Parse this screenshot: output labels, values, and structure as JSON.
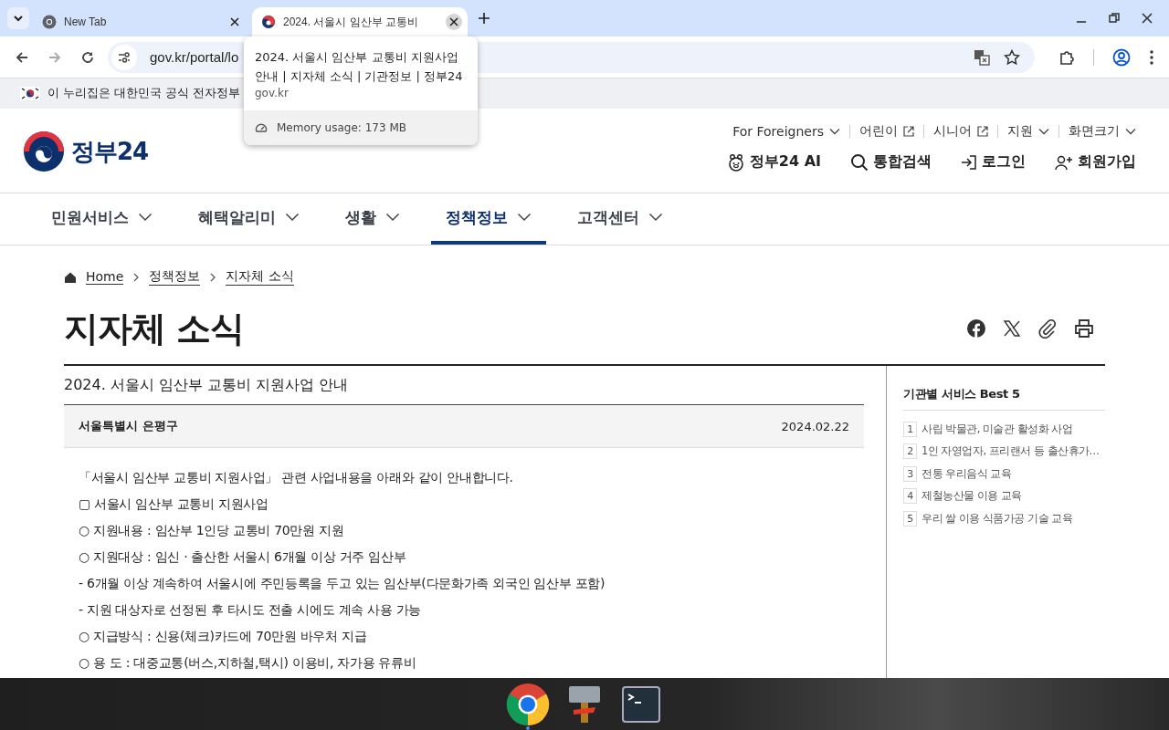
{
  "browser": {
    "tabs": [
      {
        "title": "New Tab",
        "kind": "chrome",
        "selected": false
      },
      {
        "title": "2024. 서울시 임산부 교통비",
        "kind": "site",
        "selected": true
      }
    ],
    "address": "gov.kr/portal/lo",
    "tooltip": {
      "title": "2024. 서울시 임산부 교통비 지원사업 안내 | 지자체 소식 | 기관정보 | 정부24",
      "domain": "gov.kr",
      "memory": "Memory usage: 173 MB"
    }
  },
  "gov_banner": "이 누리집은 대한민국 공식 전자정부",
  "header": {
    "logo_text": "정부24",
    "utility_links": [
      {
        "label": "For Foreigners",
        "kind": "dropdown"
      },
      {
        "label": "어린이",
        "kind": "external"
      },
      {
        "label": "시니어",
        "kind": "external"
      },
      {
        "label": "지원",
        "kind": "dropdown"
      },
      {
        "label": "화면크기",
        "kind": "dropdown"
      }
    ],
    "actions": [
      {
        "label": "정부24 AI",
        "kind": "ai"
      },
      {
        "label": "통합검색",
        "kind": "search"
      },
      {
        "label": "로그인",
        "kind": "login"
      },
      {
        "label": "회원가입",
        "kind": "signup"
      }
    ]
  },
  "nav": [
    {
      "label": "민원서비스",
      "selected": false
    },
    {
      "label": "혜택알리미",
      "selected": false
    },
    {
      "label": "생활",
      "selected": false
    },
    {
      "label": "정책정보",
      "selected": true
    },
    {
      "label": "고객센터",
      "selected": false
    }
  ],
  "breadcrumb": [
    "Home",
    "정책정보",
    "지자체 소식"
  ],
  "page_title": "지자체 소식",
  "article": {
    "title": "2024. 서울시 임산부 교통비 지원사업 안내",
    "org": "서울특별시 은평구",
    "date": "2024.02.22",
    "body": [
      "「서울시 임산부 교통비 지원사업」 관련 사업내용을 아래와 같이 안내합니다.",
      "▢ 서울시 임산부 교통비 지원사업",
      "○ 지원내용 : 임산부 1인당 교통비 70만원 지원",
      "○ 지원대상 : 임신 · 출산한 서울시 6개월 이상 거주 임산부",
      "- 6개월 이상 계속하여 서울시에 주민등록을 두고 있는 임산부(다문화가족 외국인 임산부 포함)",
      "- 지원 대상자로 선정된 후 타시도 전출 시에도 계속 사용 가능",
      "○ 지급방식 : 신용(체크)카드에 70만원 바우처 지급",
      "○ 용 도 : 대중교통(버스,지하철,택시) 이용비, 자가용 유류비"
    ]
  },
  "sidebar": {
    "title": "기관별 서비스 Best 5",
    "items": [
      {
        "rank": "1",
        "label": "사립 박물관, 미술관 활성화 사업"
      },
      {
        "rank": "2",
        "label": "1인 자영업자, 프리랜서 등 출산휴가…"
      },
      {
        "rank": "3",
        "label": "전통 우리음식 교육"
      },
      {
        "rank": "4",
        "label": "제철농산물 이용 교육"
      },
      {
        "rank": "5",
        "label": "우리 쌀 이용 식품가공 기술 교육"
      }
    ]
  },
  "taskbar": [
    {
      "kind": "chrome",
      "active": true
    },
    {
      "kind": "tool",
      "active": false
    },
    {
      "kind": "terminal",
      "active": false
    }
  ]
}
